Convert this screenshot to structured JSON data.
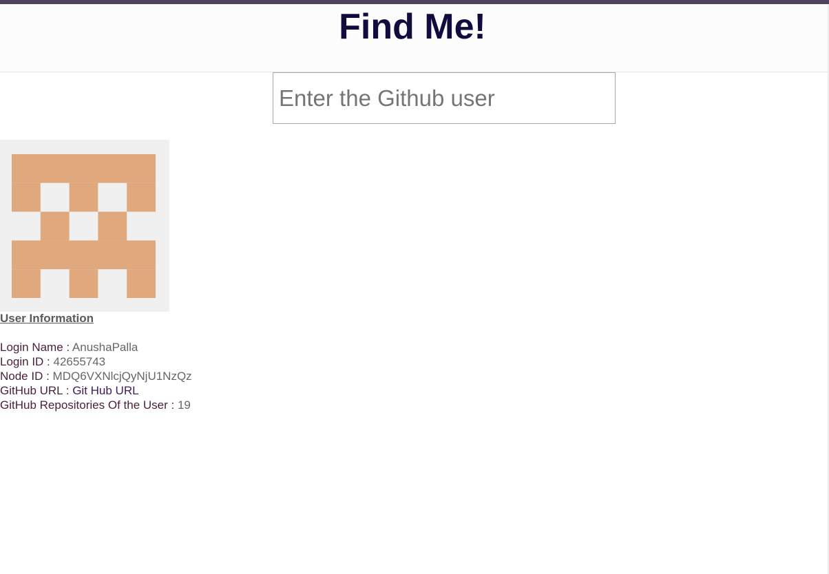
{
  "header": {
    "title": "Find Me!"
  },
  "search": {
    "placeholder": "Enter the Github user",
    "value": ""
  },
  "avatar": {
    "color": "#e0a87d",
    "background": "#f0f0f0"
  },
  "user_info": {
    "heading": "User Information",
    "login_name_label": "Login Name : ",
    "login_name_value": "AnushaPalla",
    "login_id_label": "Login ID : ",
    "login_id_value": "42655743",
    "node_id_label": "Node ID : ",
    "node_id_value": "MDQ6VXNlcjQyNjU1NzQz",
    "github_url_label": "GitHub URL : ",
    "github_url_link_text": "Git Hub URL",
    "repos_label": "GitHub Repositories Of the User : ",
    "repos_value": "19"
  },
  "colors": {
    "title": "#100d3e",
    "top_bar": "#4d4561",
    "label": "#4a1f38",
    "value": "#666666",
    "link": "#3d1a5c"
  }
}
